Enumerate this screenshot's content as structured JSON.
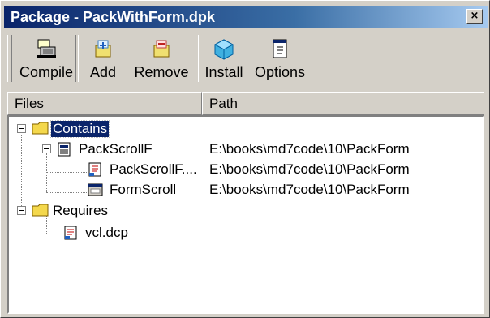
{
  "window": {
    "title": "Package - PackWithForm.dpk",
    "close_symbol": "×"
  },
  "toolbar": {
    "buttons": [
      {
        "label": "Compile",
        "icon": "compile-icon"
      },
      {
        "label": "Add",
        "icon": "add-icon"
      },
      {
        "label": "Remove",
        "icon": "remove-icon"
      },
      {
        "label": "Install",
        "icon": "install-icon"
      },
      {
        "label": "Options",
        "icon": "options-icon"
      }
    ]
  },
  "columns": {
    "files": "Files",
    "path": "Path"
  },
  "tree": {
    "contains": {
      "label": "Contains",
      "icon": "folder-icon",
      "selected": true
    },
    "packscrollf": {
      "label": "PackScrollF",
      "path": "E:\\books\\md7code\\10\\PackForm",
      "icon": "unit-icon"
    },
    "packscrollf_pas": {
      "label": "PackScrollF....",
      "path": "E:\\books\\md7code\\10\\PackForm",
      "icon": "pas-file-icon"
    },
    "formscroll": {
      "label": "FormScroll",
      "path": "E:\\books\\md7code\\10\\PackForm",
      "icon": "form-icon"
    },
    "requires": {
      "label": "Requires",
      "icon": "folder-icon"
    },
    "vcl": {
      "label": "vcl.dcp",
      "icon": "dcp-file-icon"
    }
  },
  "colors": {
    "selection": "#0a246a",
    "titlebar_start": "#0a246a",
    "titlebar_end": "#a6caf0",
    "face": "#d4d0c8"
  }
}
